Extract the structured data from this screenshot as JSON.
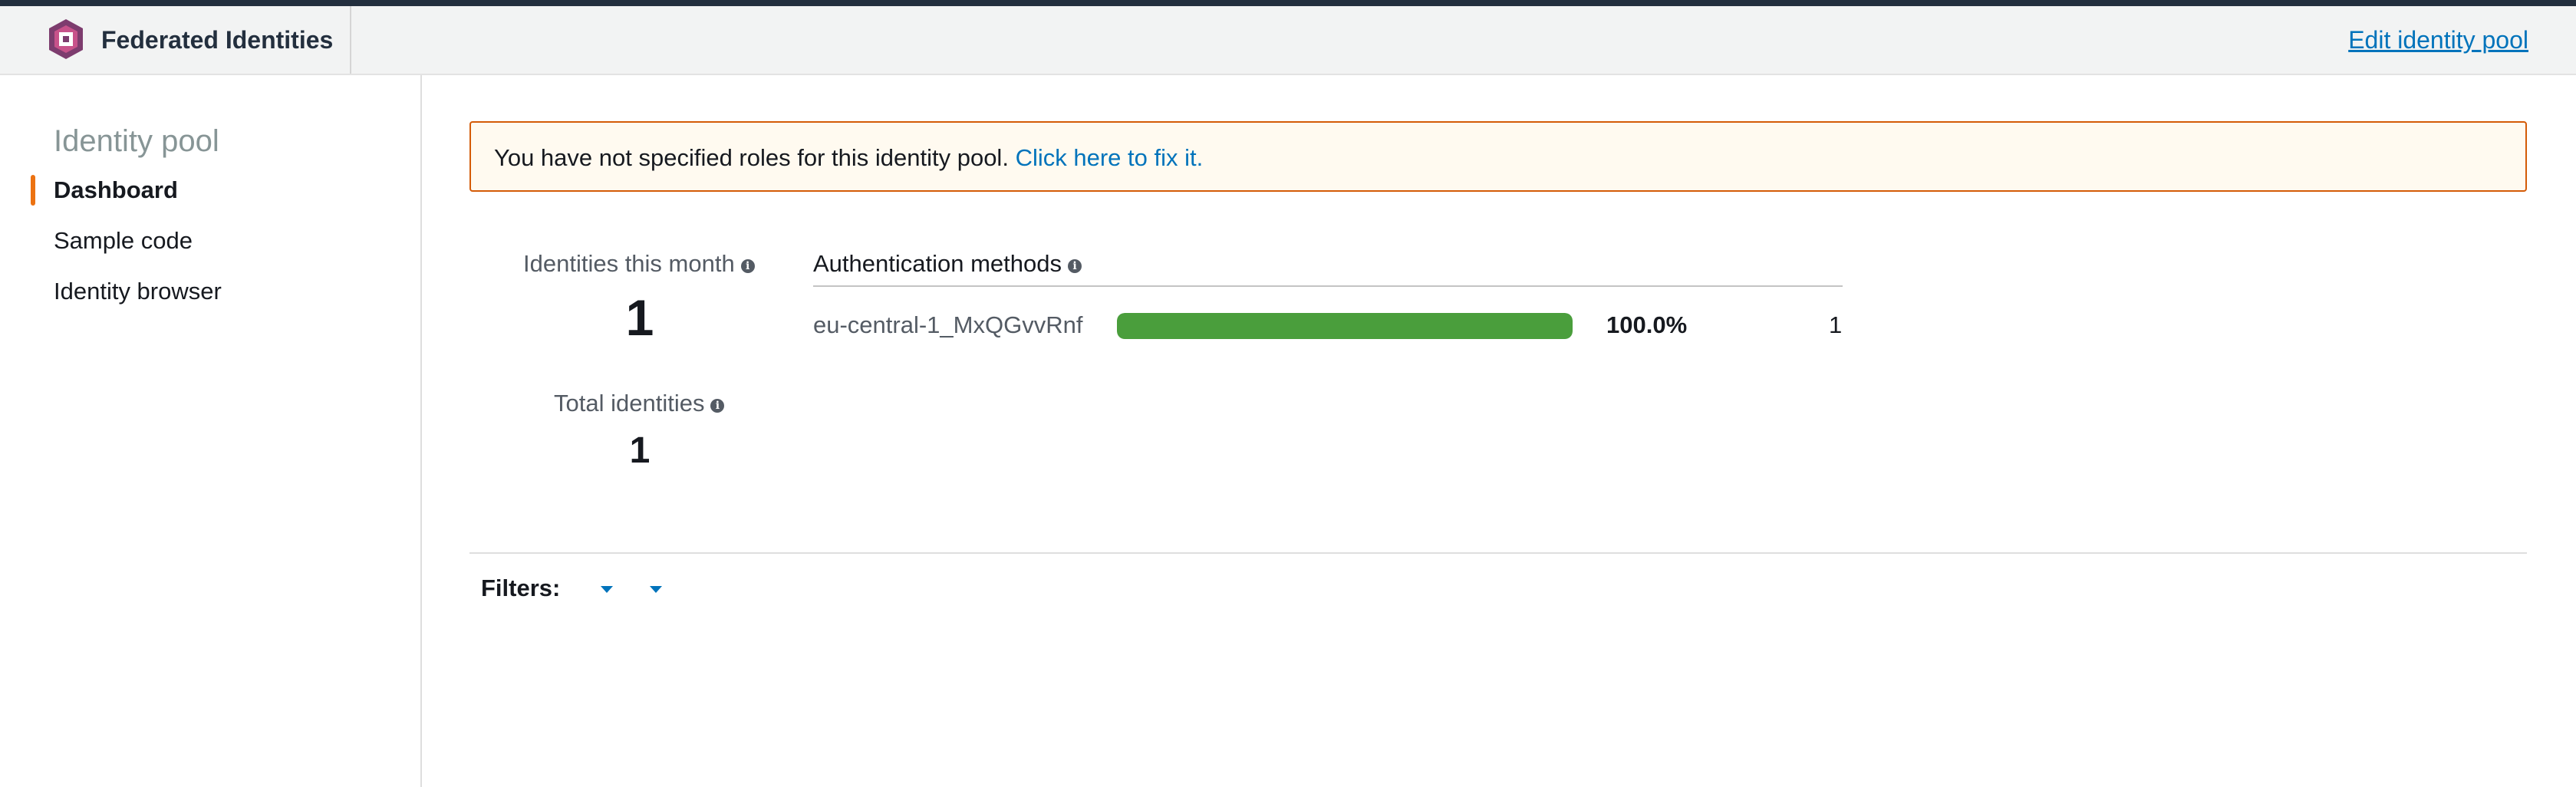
{
  "header": {
    "title": "Federated Identities",
    "edit_link": "Edit identity pool",
    "logo_icon": "cognito-logo-icon"
  },
  "sidebar": {
    "title": "Identity pool",
    "items": [
      {
        "label": "Dashboard",
        "active": true
      },
      {
        "label": "Sample code",
        "active": false
      },
      {
        "label": "Identity browser",
        "active": false
      }
    ]
  },
  "alert": {
    "message": "You have not specified roles for this identity pool.",
    "link": "Click here to fix it."
  },
  "stats": {
    "identities_this_month": {
      "label": "Identities this month",
      "value": "1"
    },
    "total_identities": {
      "label": "Total identities",
      "value": "1"
    }
  },
  "auth_methods": {
    "title": "Authentication methods",
    "rows": [
      {
        "provider": "eu-central-1_MxQGvvRnf",
        "percent_label": "100.0%",
        "fraction": 1.0,
        "count": "1"
      }
    ]
  },
  "filters": {
    "label": "Filters:"
  },
  "colors": {
    "accent_orange": "#ec7211",
    "link_blue": "#0073bb",
    "bar_green": "#4a9e3c",
    "alert_border": "#d45b07",
    "alert_bg": "#fffaf0"
  }
}
